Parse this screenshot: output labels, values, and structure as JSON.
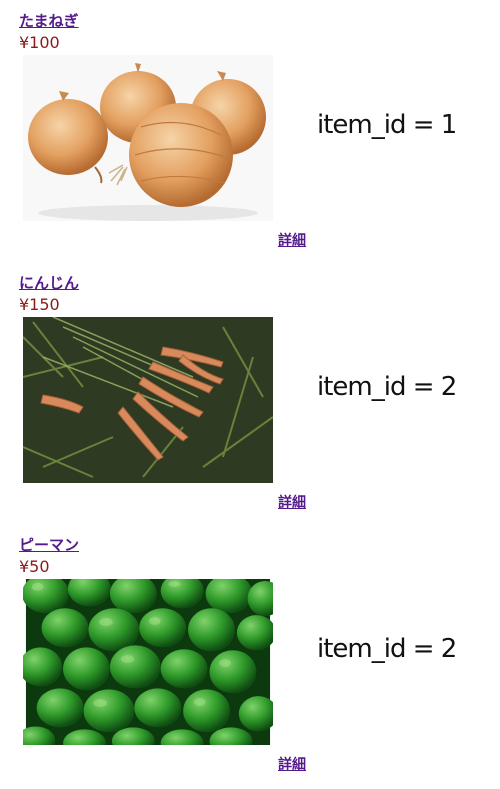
{
  "products": [
    {
      "name": "たまねぎ",
      "price": "¥100",
      "image_alt": "onion-photo",
      "item_id_label": "item_id = 1",
      "detail_label": "詳細"
    },
    {
      "name": "にんじん",
      "price": "¥150",
      "image_alt": "carrot-photo",
      "item_id_label": "item_id = 2",
      "detail_label": "詳細"
    },
    {
      "name": "ピーマン",
      "price": "¥50",
      "image_alt": "green-pepper-photo",
      "item_id_label": "item_id = 2",
      "detail_label": "詳細"
    }
  ],
  "colors": {
    "link": "#551a8b",
    "price": "#8b1a1a"
  }
}
